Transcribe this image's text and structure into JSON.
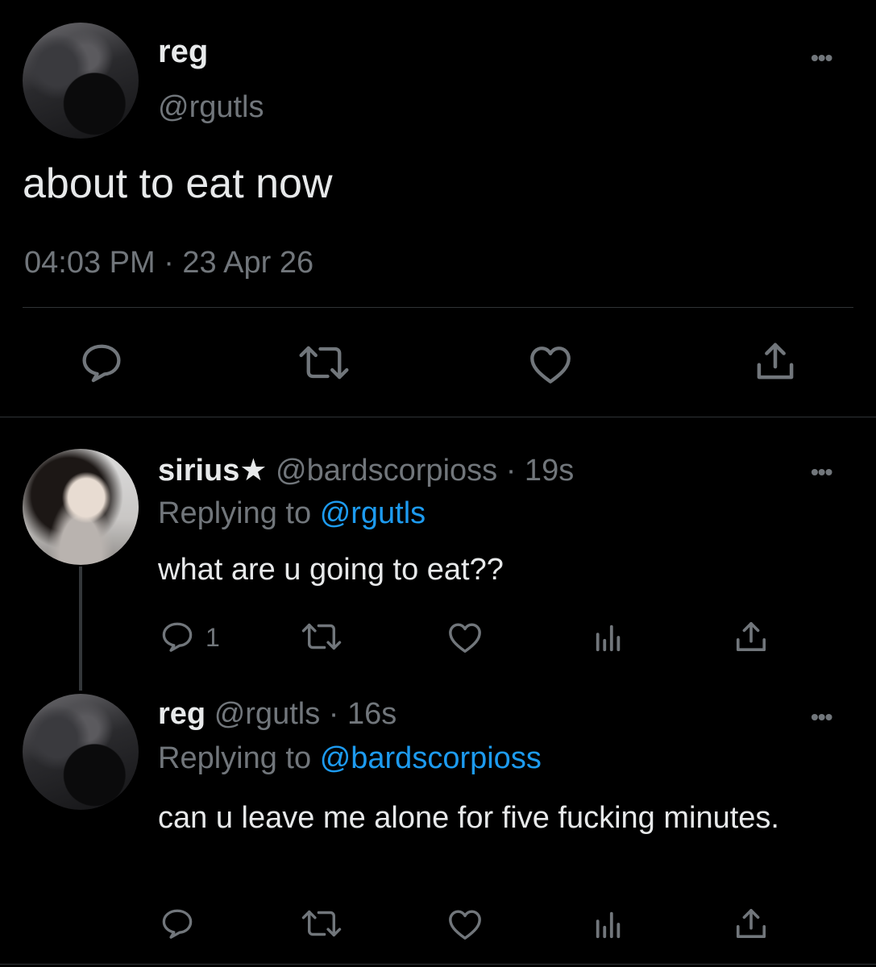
{
  "main_tweet": {
    "display_name": "reg",
    "handle": "@rgutls",
    "text": "about to eat now",
    "timestamp": "04:03 PM · 23 Apr 26",
    "more": "•••"
  },
  "replies": [
    {
      "display_name": "sirius★",
      "handle": "@bardscorpioss",
      "time": "· 19s",
      "replying_label": "Replying to",
      "replying_handle": "@rgutls",
      "text": "what are u going to eat??",
      "reply_count": "1",
      "more": "•••"
    },
    {
      "display_name": "reg",
      "handle": "@rgutls",
      "time": "· 16s",
      "replying_label": "Replying to",
      "replying_handle": "@bardscorpioss",
      "text": "can u leave me alone for five fucking minutes.",
      "more": "•••"
    }
  ],
  "colors": {
    "background": "#000000",
    "text": "#e7e9ea",
    "muted": "#71767b",
    "link": "#1d9bf0",
    "divider": "#2f3336"
  },
  "icons": [
    "reply-icon",
    "retweet-icon",
    "like-icon",
    "views-icon",
    "share-icon",
    "more-icon"
  ]
}
